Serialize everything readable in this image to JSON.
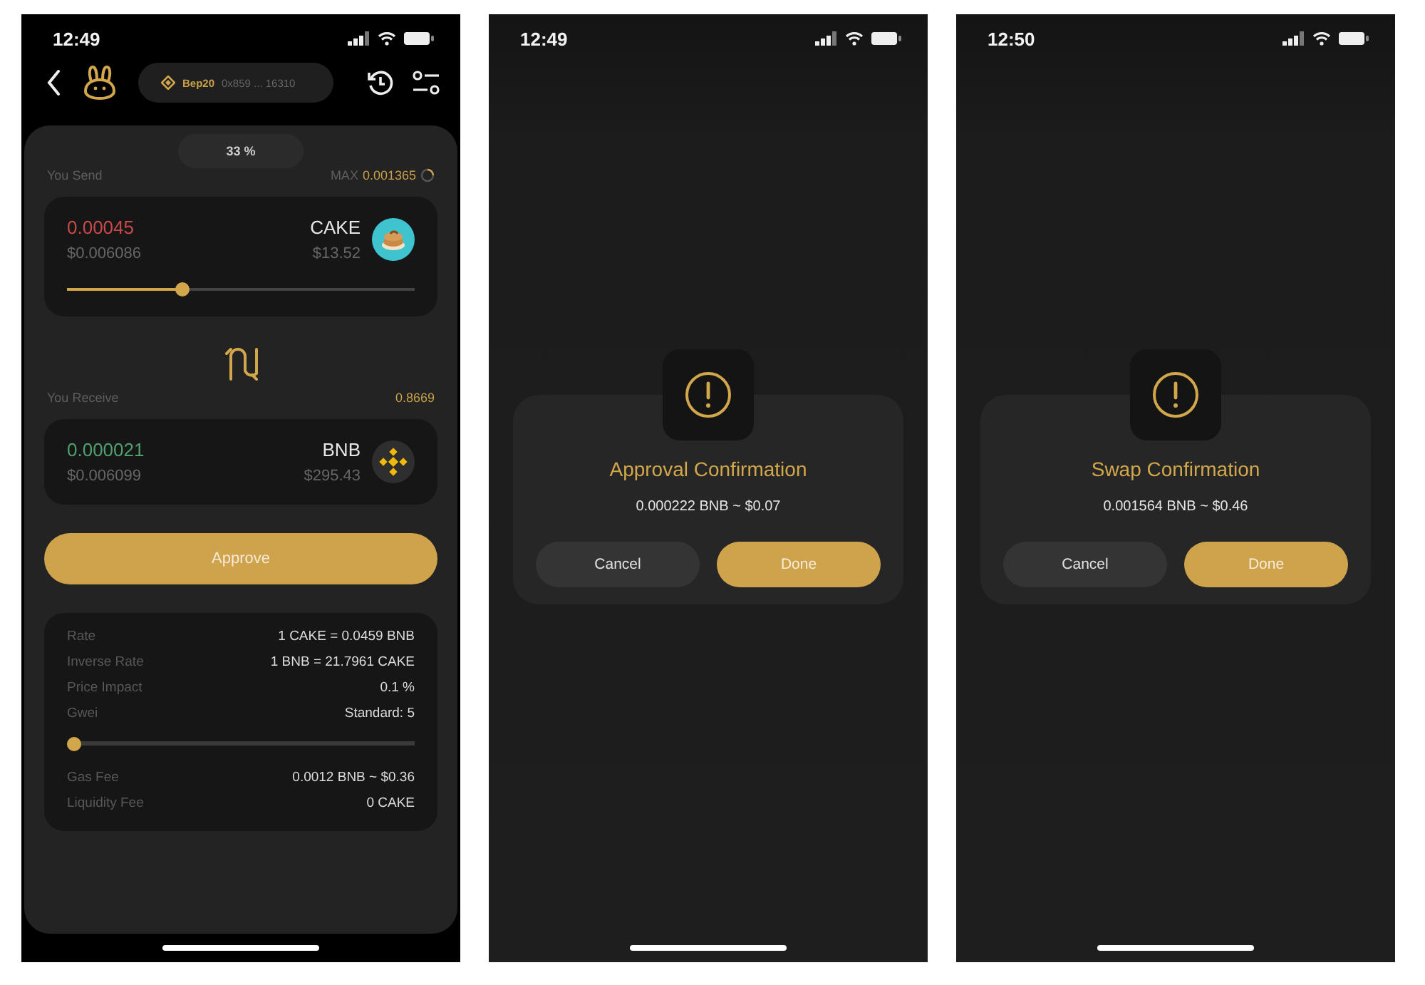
{
  "screens": [
    {
      "kind": "swap",
      "status_bar": {
        "time": "12:49"
      },
      "header": {
        "network": "Bep20",
        "address": "0x859 ... 16310"
      },
      "percent": "33 %",
      "send": {
        "label": "You Send",
        "max_label": "MAX",
        "max_value": "0.001365",
        "amount": "0.00045",
        "fiat": "$0.006086",
        "token": "CAKE",
        "price": "$13.52",
        "level": 0.33
      },
      "receive": {
        "label": "You Receive",
        "value": "0.8669",
        "amount": "0.000021",
        "fiat": "$0.006099",
        "token": "BNB",
        "price": "$295.43"
      },
      "action": "Approve",
      "details": [
        {
          "kind": "row",
          "label": "Rate",
          "value": "1 CAKE = 0.0459 BNB"
        },
        {
          "kind": "row",
          "label": "Inverse Rate",
          "value": "1 BNB = 21.7961 CAKE"
        },
        {
          "kind": "row",
          "label": "Price Impact",
          "value": "0.1 %"
        },
        {
          "kind": "row",
          "label": "Gwei",
          "value": "Standard: 5"
        },
        {
          "kind": "slider",
          "level": 0
        },
        {
          "kind": "row",
          "label": "Gas Fee",
          "value": "0.0012 BNB ~ $0.36"
        },
        {
          "kind": "row",
          "label": "Liquidity Fee",
          "value": "0 CAKE"
        }
      ]
    },
    {
      "kind": "dialog",
      "status_bar": {
        "time": "12:49"
      },
      "title": "Approval Confirmation",
      "amount": "0.000222 BNB ~ $0.07",
      "buttons": [
        {
          "label": "Cancel",
          "kind": "secondary"
        },
        {
          "label": "Done",
          "kind": "primary"
        }
      ]
    },
    {
      "kind": "dialog",
      "status_bar": {
        "time": "12:50"
      },
      "title": "Swap Confirmation",
      "amount": "0.001564 BNB ~ $0.46",
      "buttons": [
        {
          "label": "Cancel",
          "kind": "secondary"
        },
        {
          "label": "Done",
          "kind": "primary"
        }
      ]
    }
  ]
}
